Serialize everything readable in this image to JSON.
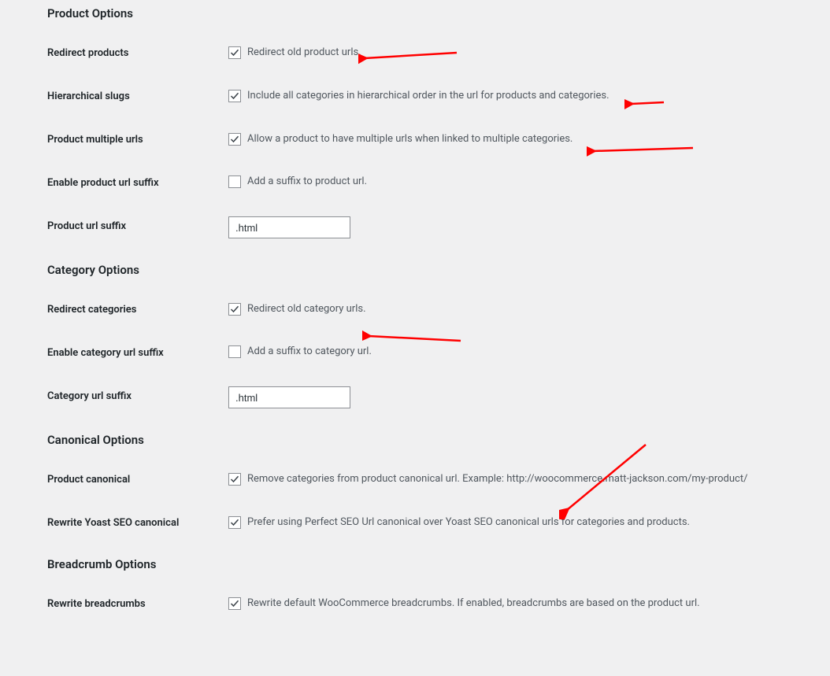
{
  "sections": {
    "product": {
      "title": "Product Options",
      "redirect_products": {
        "label": "Redirect products",
        "text": "Redirect old product urls.",
        "checked": true
      },
      "hierarchical_slugs": {
        "label": "Hierarchical slugs",
        "text": "Include all categories in hierarchical order in the url for products and categories.",
        "checked": true
      },
      "multiple_urls": {
        "label": "Product multiple urls",
        "text": "Allow a product to have multiple urls when linked to multiple categories.",
        "checked": true
      },
      "enable_suffix": {
        "label": "Enable product url suffix",
        "text": "Add a suffix to product url.",
        "checked": false
      },
      "suffix": {
        "label": "Product url suffix",
        "value": ".html"
      }
    },
    "category": {
      "title": "Category Options",
      "redirect_categories": {
        "label": "Redirect categories",
        "text": "Redirect old category urls.",
        "checked": true
      },
      "enable_suffix": {
        "label": "Enable category url suffix",
        "text": "Add a suffix to category url.",
        "checked": false
      },
      "suffix": {
        "label": "Category url suffix",
        "value": ".html"
      }
    },
    "canonical": {
      "title": "Canonical Options",
      "product_canonical": {
        "label": "Product canonical",
        "text": "Remove categories from product canonical url. Example: http://woocommerce.matt-jackson.com/my-product/",
        "checked": true
      },
      "yoast": {
        "label": "Rewrite Yoast SEO canonical",
        "text": "Prefer using Perfect SEO Url canonical over Yoast SEO canonical urls for categories and products.",
        "checked": true
      }
    },
    "breadcrumb": {
      "title": "Breadcrumb Options",
      "rewrite": {
        "label": "Rewrite breadcrumbs",
        "text": "Rewrite default WooCommerce breadcrumbs. If enabled, breadcrumbs are based on the product url.",
        "checked": true
      }
    }
  }
}
